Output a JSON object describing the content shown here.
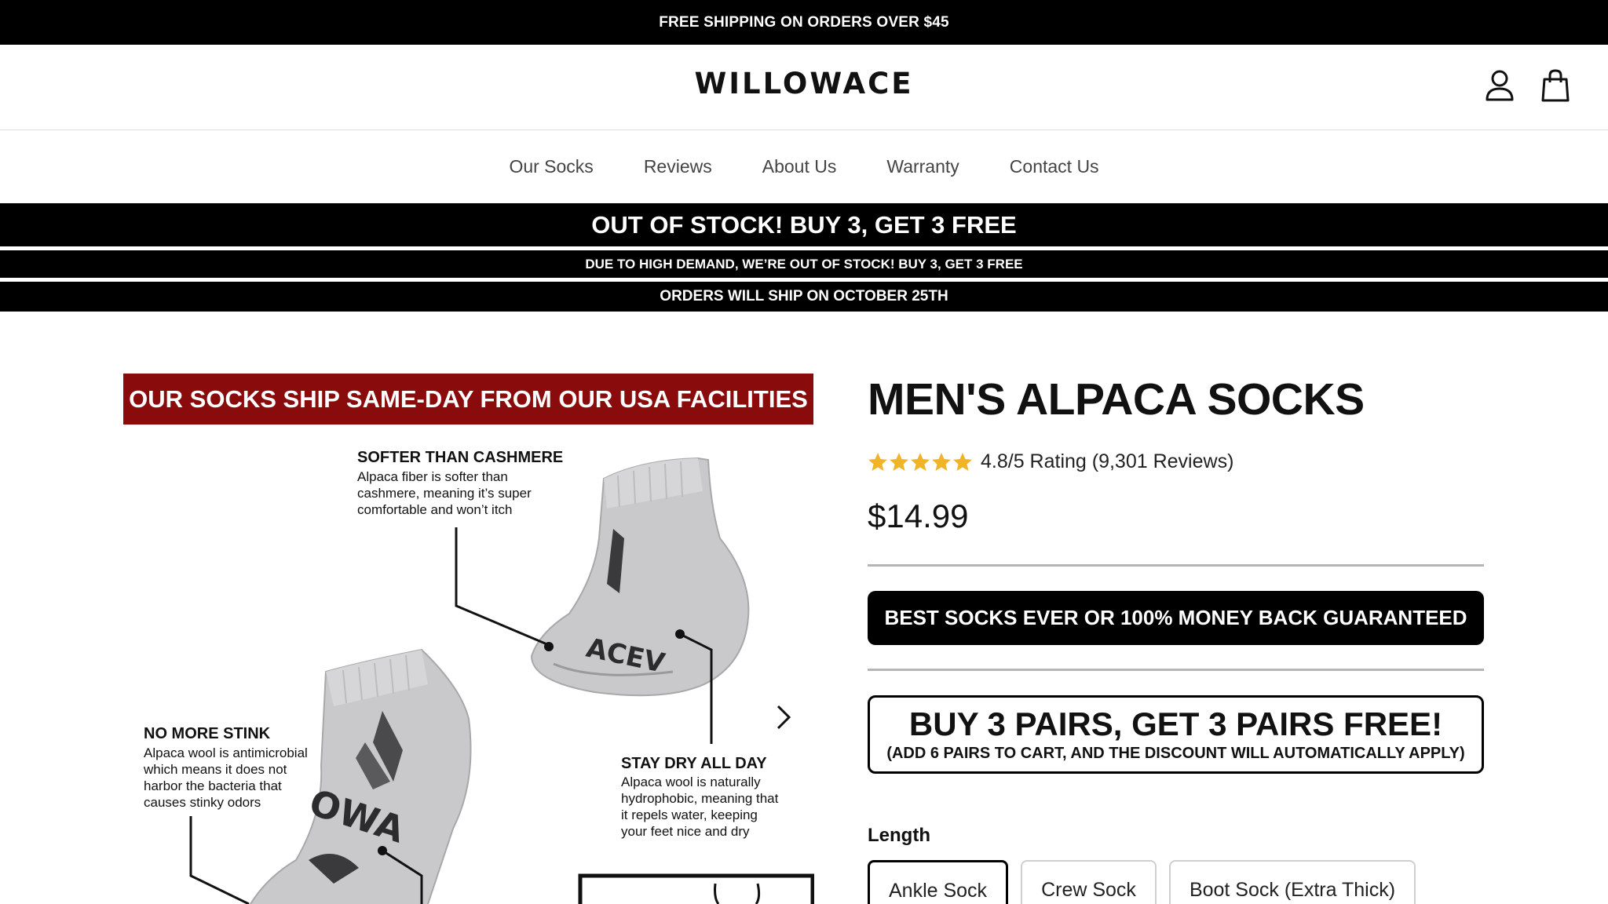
{
  "announcement": "FREE SHIPPING ON ORDERS OVER $45",
  "brand": "WILLOWACE",
  "header_icons": [
    "account-icon",
    "cart-icon"
  ],
  "nav": [
    "Our Socks",
    "Reviews",
    "About Us",
    "Warranty",
    "Contact Us"
  ],
  "promo": {
    "line1": "OUT OF STOCK! BUY 3, GET 3 FREE",
    "line2": "DUE TO HIGH DEMAND, WE’RE OUT OF STOCK! BUY 3, GET 3 FREE",
    "line3": "ORDERS WILL SHIP ON OCTOBER 25TH"
  },
  "gallery": {
    "banner": "OUR SOCKS SHIP SAME-DAY FROM OUR USA FACILITIES",
    "callouts": [
      {
        "title": "SOFTER THAN CASHMERE",
        "lines": [
          "Alpaca fiber is softer than",
          "cashmere, meaning it’s super",
          "comfortable and won’t itch"
        ]
      },
      {
        "title": "NO MORE STINK",
        "lines": [
          "Alpaca wool is antimicrobial",
          "which means it does not",
          "harbor the bacteria that",
          "causes stinky odors"
        ]
      },
      {
        "title": "STAY DRY ALL DAY",
        "lines": [
          "Alpaca wool is naturally",
          "hydrophobic, meaning that",
          "it repels water, keeping",
          "your feet nice and dry"
        ]
      }
    ],
    "sock_text_1": "ACEV",
    "sock_text_2": "OWA"
  },
  "product": {
    "title": "MEN'S ALPACA SOCKS",
    "rating_stars": 5,
    "rating_text": "4.8/5 Rating (9,301 Reviews)",
    "price": "$14.99",
    "guarantee": "BEST SOCKS EVER OR 100% MONEY BACK GUARANTEED",
    "offer_main": "BUY 3 PAIRS, GET 3 PAIRS FREE!",
    "offer_sub": "(ADD 6 PAIRS TO CART, AND THE DISCOUNT WILL AUTOMATICALLY APPLY)",
    "length_label": "Length",
    "length_options": [
      "Ankle Sock",
      "Crew Sock",
      "Boot Sock (Extra Thick)"
    ],
    "length_selected": "Ankle Sock"
  },
  "colors": {
    "banner_red": "#8a0b0b",
    "star": "#f0b429",
    "black": "#000000"
  }
}
